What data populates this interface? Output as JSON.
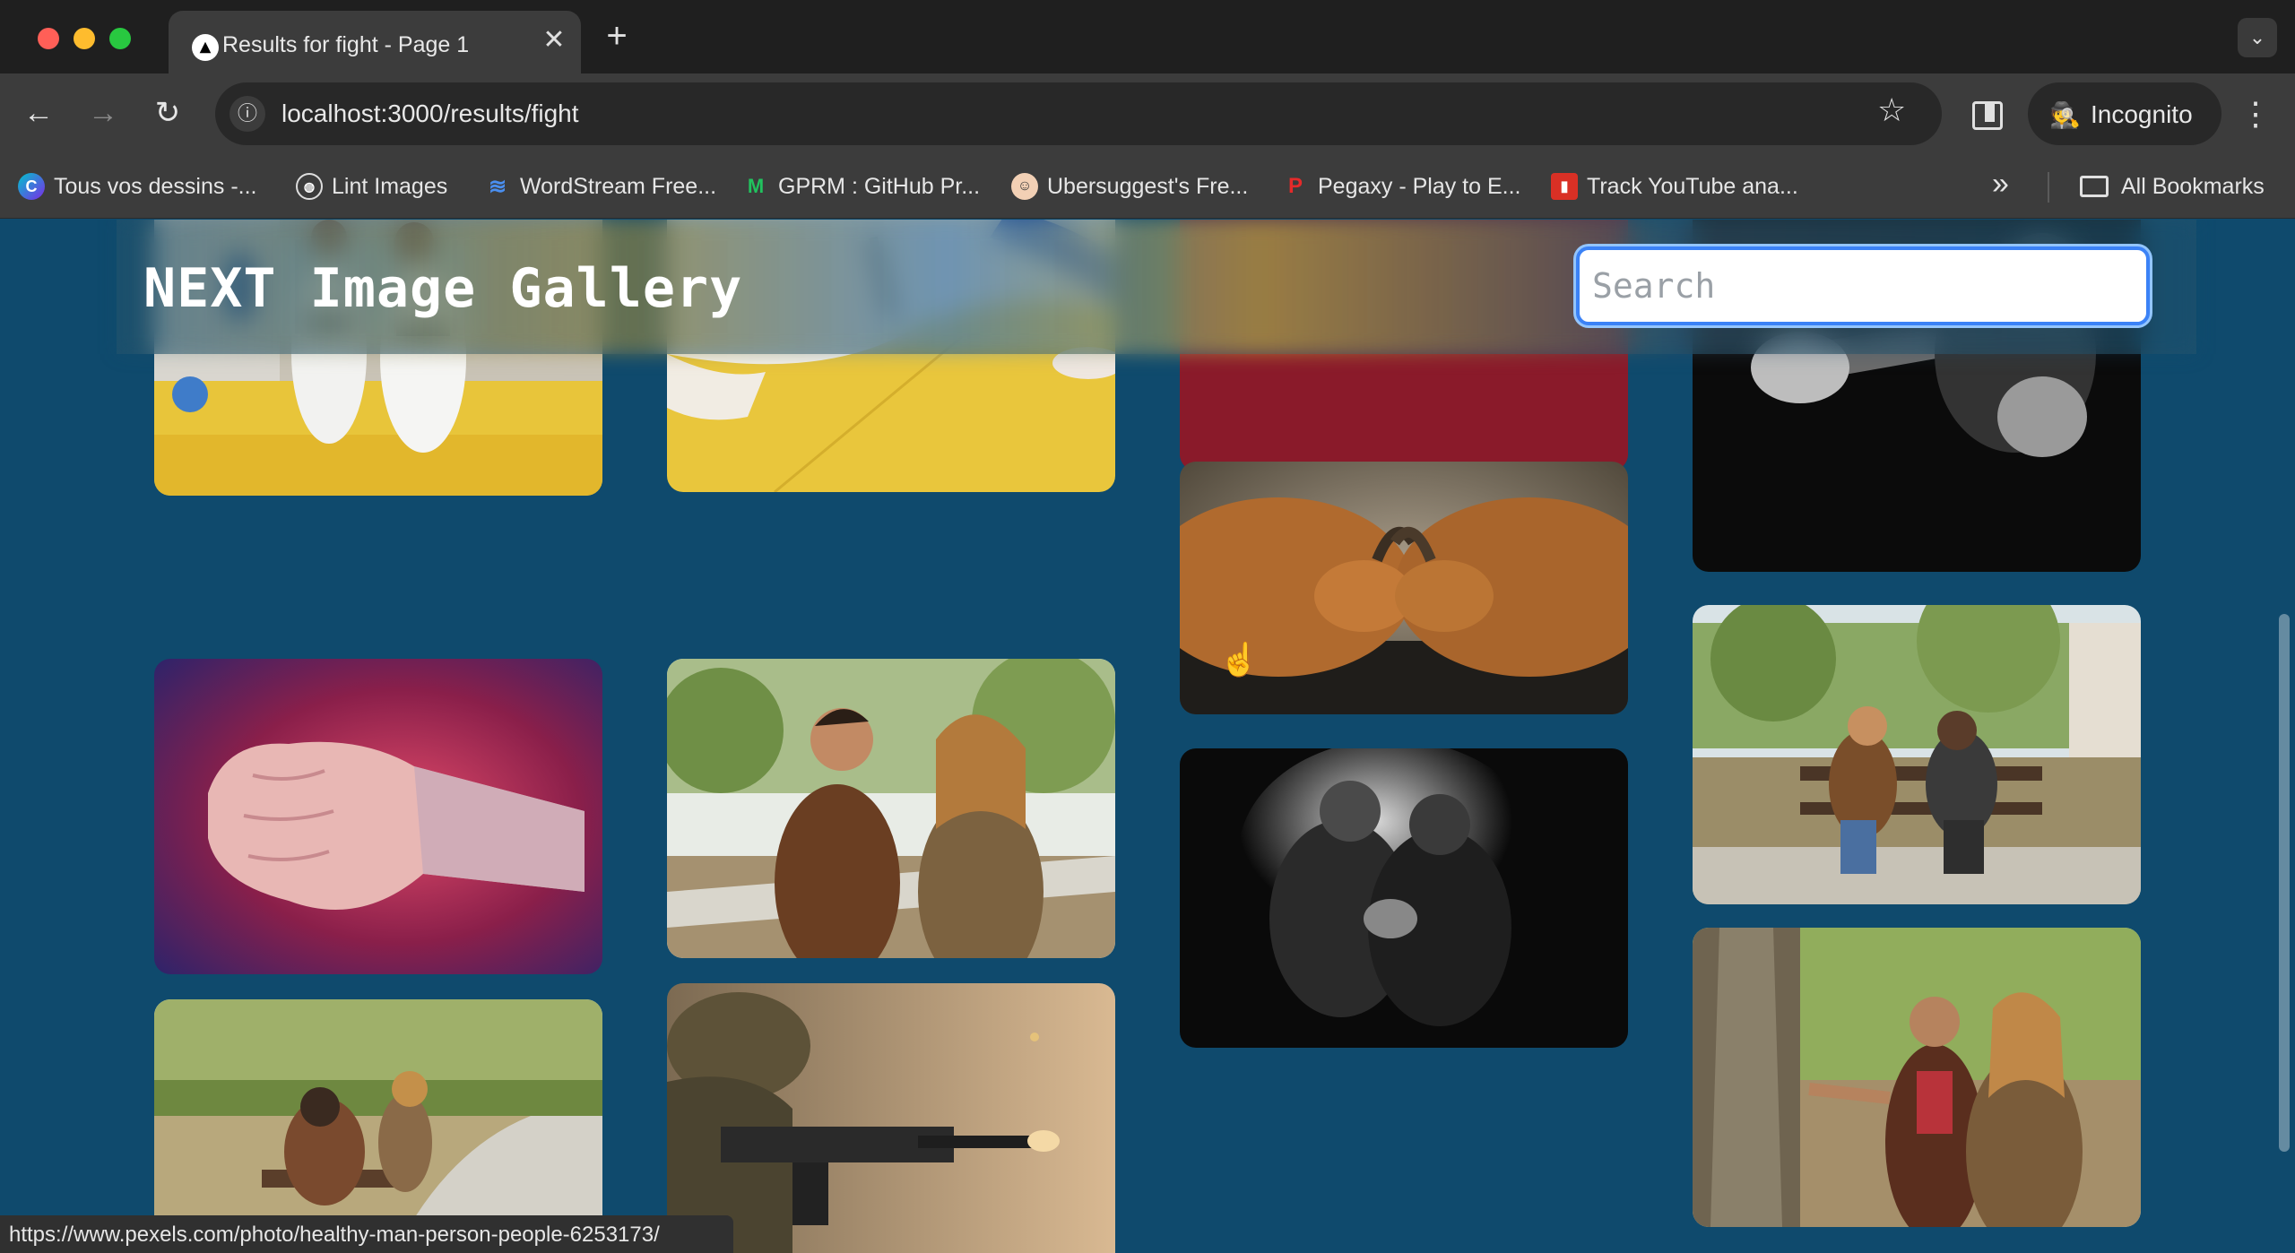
{
  "browser": {
    "tab_title": "Results for fight - Page 1",
    "tab_close": "✕",
    "new_tab": "+",
    "url": "localhost:3000/results/fight",
    "incognito_label": "Incognito",
    "bookmarks": [
      "Tous vos dessins -...",
      "Lint Images",
      "WordStream Free...",
      "GPRM : GitHub Pr...",
      "Ubersuggest's Fre...",
      "Pegaxy - Play to E...",
      "Track YouTube ana..."
    ],
    "all_bookmarks": "All Bookmarks",
    "status_url": "https://www.pexels.com/photo/healthy-man-person-people-6253173/"
  },
  "header": {
    "title": "NEXT Image Gallery",
    "search_placeholder": "Search"
  },
  "gallery": {
    "images": [
      {
        "id": "judo-practice"
      },
      {
        "id": "judo-mat-close"
      },
      {
        "id": "red-partial"
      },
      {
        "id": "boxer-punch-bw"
      },
      {
        "id": "goats-head-butt"
      },
      {
        "id": "couple-bench-upset"
      },
      {
        "id": "fist-close-up"
      },
      {
        "id": "couple-arguing-park"
      },
      {
        "id": "two-men-shadow-bw"
      },
      {
        "id": "couple-tree-park"
      },
      {
        "id": "man-head-in-hands-bench"
      },
      {
        "id": "soldier-rifle"
      }
    ]
  },
  "colors": {
    "page_bg": "#0f4a6d",
    "search_border": "#3b82f6"
  }
}
